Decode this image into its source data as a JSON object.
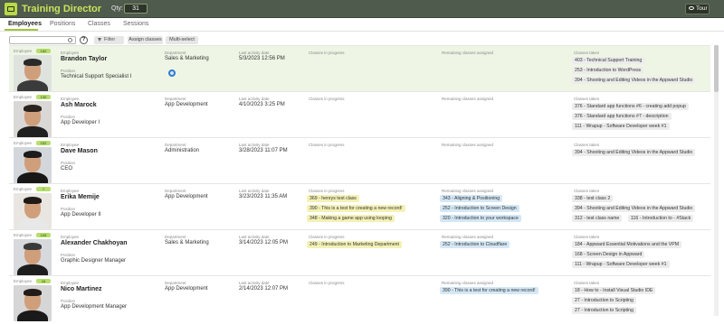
{
  "app": {
    "title": "Training Director",
    "qty_label": "Qty:",
    "qty_value": "31",
    "tour_label": "Tour"
  },
  "tabs": [
    {
      "label": "Employees",
      "active": true
    },
    {
      "label": "Positions",
      "active": false
    },
    {
      "label": "Classes",
      "active": false
    },
    {
      "label": "Sessions",
      "active": false
    }
  ],
  "toolbar": {
    "search_placeholder": "",
    "help_label": "?",
    "filter_label": "Filter",
    "assign_label": "Assign classes",
    "multi_label": "Multi-select"
  },
  "captions": {
    "employee": "Employee",
    "position": "Position",
    "department": "Department",
    "last_activity": "Last activity date",
    "in_progress": "Classes in progress",
    "remaining": "Remaining classes assigned",
    "taken": "Classes taken"
  },
  "colors": {
    "accent": "#9fc53a",
    "header_bg": "#4f5b4c",
    "title": "#c9e35c"
  },
  "employees": [
    {
      "badge": "152",
      "name": "Brandon Taylor",
      "position": "Technical Support Specialist I",
      "department": "Sales & Marketing",
      "last_activity": "5/3/2023 12:56 PM",
      "in_progress": [],
      "remaining": [],
      "taken": [
        "403 - Technical Support Training",
        "253 - Introduction to WordPress",
        "394 - Shooting and Editing Videos in the Appward Studio"
      ]
    },
    {
      "badge": "130",
      "name": "Ash Marock",
      "position": "App Developer I",
      "department": "App Development",
      "last_activity": "4/10/2023 3:25 PM",
      "in_progress": [],
      "remaining": [],
      "taken": [
        "376 - Standard app functions #6 - creating add popup",
        "376 - Standard app functions #7 - description",
        "111 - Wrapup - Software Developer week #1"
      ]
    },
    {
      "badge": "152",
      "name": "Dave Mason",
      "position": "CEO",
      "department": "Administration",
      "last_activity": "3/28/2023 11:07 PM",
      "in_progress": [],
      "remaining": [],
      "taken": [
        "394 - Shooting and Editing Videos in the Appward Studio"
      ]
    },
    {
      "badge": "7",
      "name": "Erika Memije",
      "position": "App Developer II",
      "department": "App Development",
      "last_activity": "3/23/2023 11:35 AM",
      "in_progress": [
        "369 - henrys test class",
        "390 - This is a test for creating a new record!",
        "348 - Making a game app using looping"
      ],
      "remaining": [
        "343 - Aligning & Positioning",
        "252 - Introduction to Screen Design",
        "320 - Introduction to your workspace"
      ],
      "taken": [
        "338 - test class 2",
        "394 - Shooting and Editing Videos in the Appward Studio",
        "312 - test class name",
        "116 - Introduction to - #Stack"
      ]
    },
    {
      "badge": "105",
      "name": "Alexander Chakhoyan",
      "position": "Graphic Designer Manager",
      "department": "Sales & Marketing",
      "last_activity": "3/14/2023 12:05 PM",
      "in_progress": [
        "249 - Introduction to Marketing Department"
      ],
      "remaining": [
        "252 - Introduction to Cloudflare"
      ],
      "taken": [
        "184 - Appward Essential Motivations and the VPM",
        "168 - Screen Design in Appward",
        "111 - Wrapup - Software Developer week #1"
      ]
    },
    {
      "badge": "16",
      "name": "Nico Martinez",
      "position": "App Development Manager",
      "department": "App Development",
      "last_activity": "2/14/2023 12:07 PM",
      "in_progress": [],
      "remaining": [
        "390 - This is a test for creating a new record!"
      ],
      "taken": [
        "18 - How to - Install Visual Studio IDE",
        "27 - Introduction to Scripting",
        "27 - Introduction to Scripting"
      ]
    }
  ]
}
